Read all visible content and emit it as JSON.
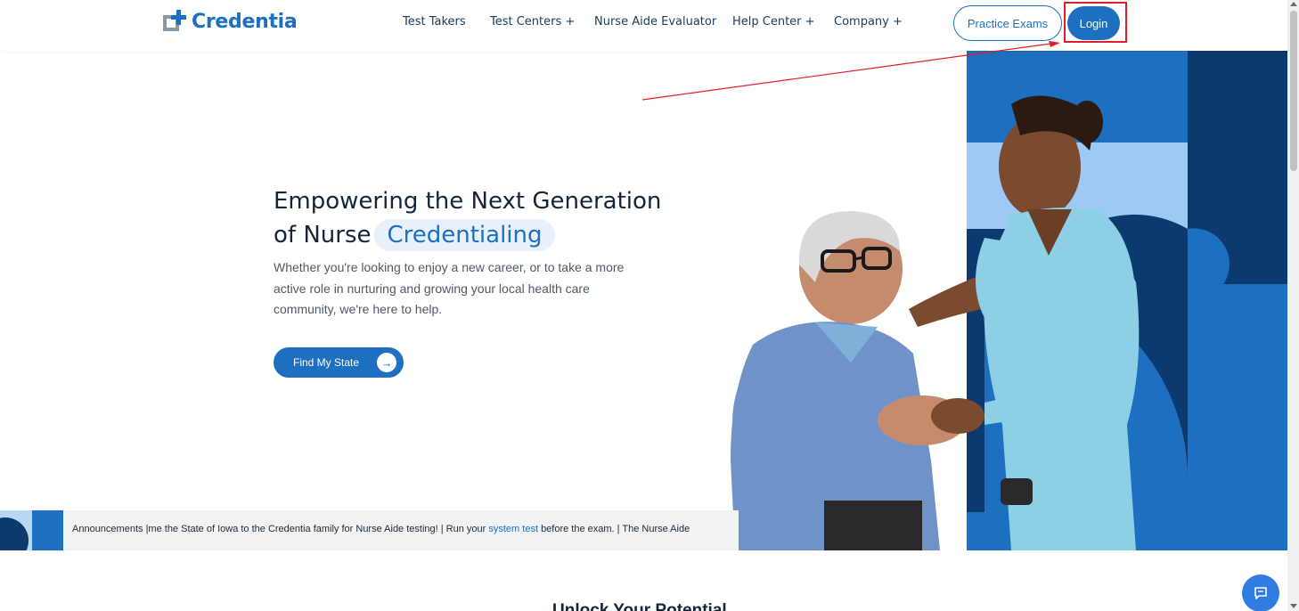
{
  "brand": {
    "name": "Credentia"
  },
  "nav": {
    "items": [
      {
        "label": "Test Takers"
      },
      {
        "label": "Test Centers +"
      },
      {
        "label": "Nurse Aide Evaluator"
      },
      {
        "label": "Help Center +"
      },
      {
        "label": "Company +"
      }
    ],
    "practice_label": "Practice Exams",
    "login_label": "Login"
  },
  "hero": {
    "title_line1": "Empowering the Next Generation",
    "title_line2": "of Nurse",
    "title_highlight": "Credentialing",
    "subtitle": "Whether you're looking to enjoy a new career, or to take a more active role in nurturing and growing your local health care community, we're here to help.",
    "cta_label": "Find My State"
  },
  "announcement": {
    "label": "Announcements",
    "text_before": "|me the State of Iowa to the Credentia family for Nurse Aide testing! | Run your",
    "link": "system test",
    "text_after": "before the exam. | The Nurse Aide"
  },
  "section": {
    "title": "Unlock Your Potential"
  },
  "colors": {
    "primary": "#1d6fc0",
    "dark_blue": "#0d3a6e",
    "light_blue": "#b9d6f3",
    "highlight_red": "#e11d2a"
  }
}
